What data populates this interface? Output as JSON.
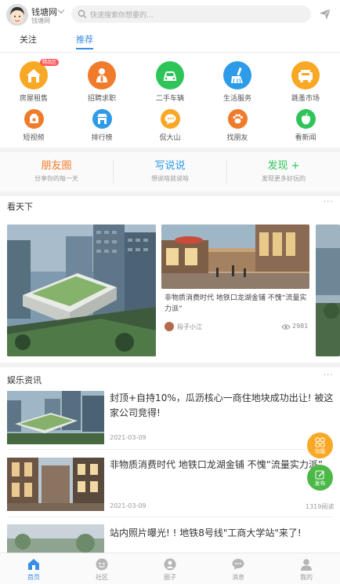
{
  "header": {
    "site_name": "钱塘网",
    "site_sub": "钱塘网",
    "search_placeholder": "快速搜索你想要的..."
  },
  "tabs": [
    {
      "label": "关注"
    },
    {
      "label": "推荐"
    }
  ],
  "categories": [
    {
      "label": "房屋租售",
      "icon": "house-icon",
      "color": "#f9a825",
      "badge": "精品区"
    },
    {
      "label": "招聘求职",
      "icon": "person-tie-icon",
      "color": "#f07b2b"
    },
    {
      "label": "二手车辆",
      "icon": "car-icon",
      "color": "#2ec45a"
    },
    {
      "label": "生活服务",
      "icon": "broom-icon",
      "color": "#2d9be8"
    },
    {
      "label": "跳蚤市场",
      "icon": "truck-icon",
      "color": "#f9a825"
    },
    {
      "label": "短视频",
      "icon": "video-icon",
      "color": "#f07b2b"
    },
    {
      "label": "排行榜",
      "icon": "store-icon",
      "color": "#2d9be8"
    },
    {
      "label": "侃大山",
      "icon": "chat-icon",
      "color": "#f9a825"
    },
    {
      "label": "找朋友",
      "icon": "paw-icon",
      "color": "#f07b2b"
    },
    {
      "label": "看新闻",
      "icon": "apple-icon",
      "color": "#2ec45a"
    }
  ],
  "social": [
    {
      "title": "朋友圈",
      "sub": "分享你的每一天",
      "color": "#f07b2b"
    },
    {
      "title": "写说说",
      "sub": "想说啥就说啥",
      "color": "#2d9be8"
    },
    {
      "title": "发现 +",
      "sub": "发现更多好玩的",
      "color": "#2ec45a"
    }
  ],
  "section1": {
    "title": "看天下",
    "more": "···"
  },
  "feature_card": {
    "caption": "非物质消费时代 地铁口龙湖金铺 不愧“流量实力派”",
    "author": "段子小江",
    "views": "2981"
  },
  "section2": {
    "title": "娱乐资讯",
    "more": "···"
  },
  "news": [
    {
      "title": "封顶+自持10%，瓜沥核心一商住地块成功出让! 被这家公司竞得!",
      "date": "2021-03-09",
      "reads": ""
    },
    {
      "title": "非物质消费时代 地铁口龙湖金铺 不愧“流量实力派”",
      "date": "2021-03-09",
      "reads": "1319阅读"
    },
    {
      "title": "站内照片曝光! ! 地铁8号线\"工商大学站\"来了!",
      "date": "",
      "reads": ""
    }
  ],
  "fabs": [
    {
      "label": "功能",
      "color": "#f9a825",
      "icon": "grid-icon"
    },
    {
      "label": "发布",
      "color": "#4cb848",
      "icon": "edit-icon"
    }
  ],
  "bottom_nav": [
    {
      "label": "首页",
      "icon": "home-icon"
    },
    {
      "label": "社区",
      "icon": "community-icon"
    },
    {
      "label": "圈子",
      "icon": "circle-icon"
    },
    {
      "label": "消息",
      "icon": "message-icon"
    },
    {
      "label": "我的",
      "icon": "user-icon"
    }
  ]
}
